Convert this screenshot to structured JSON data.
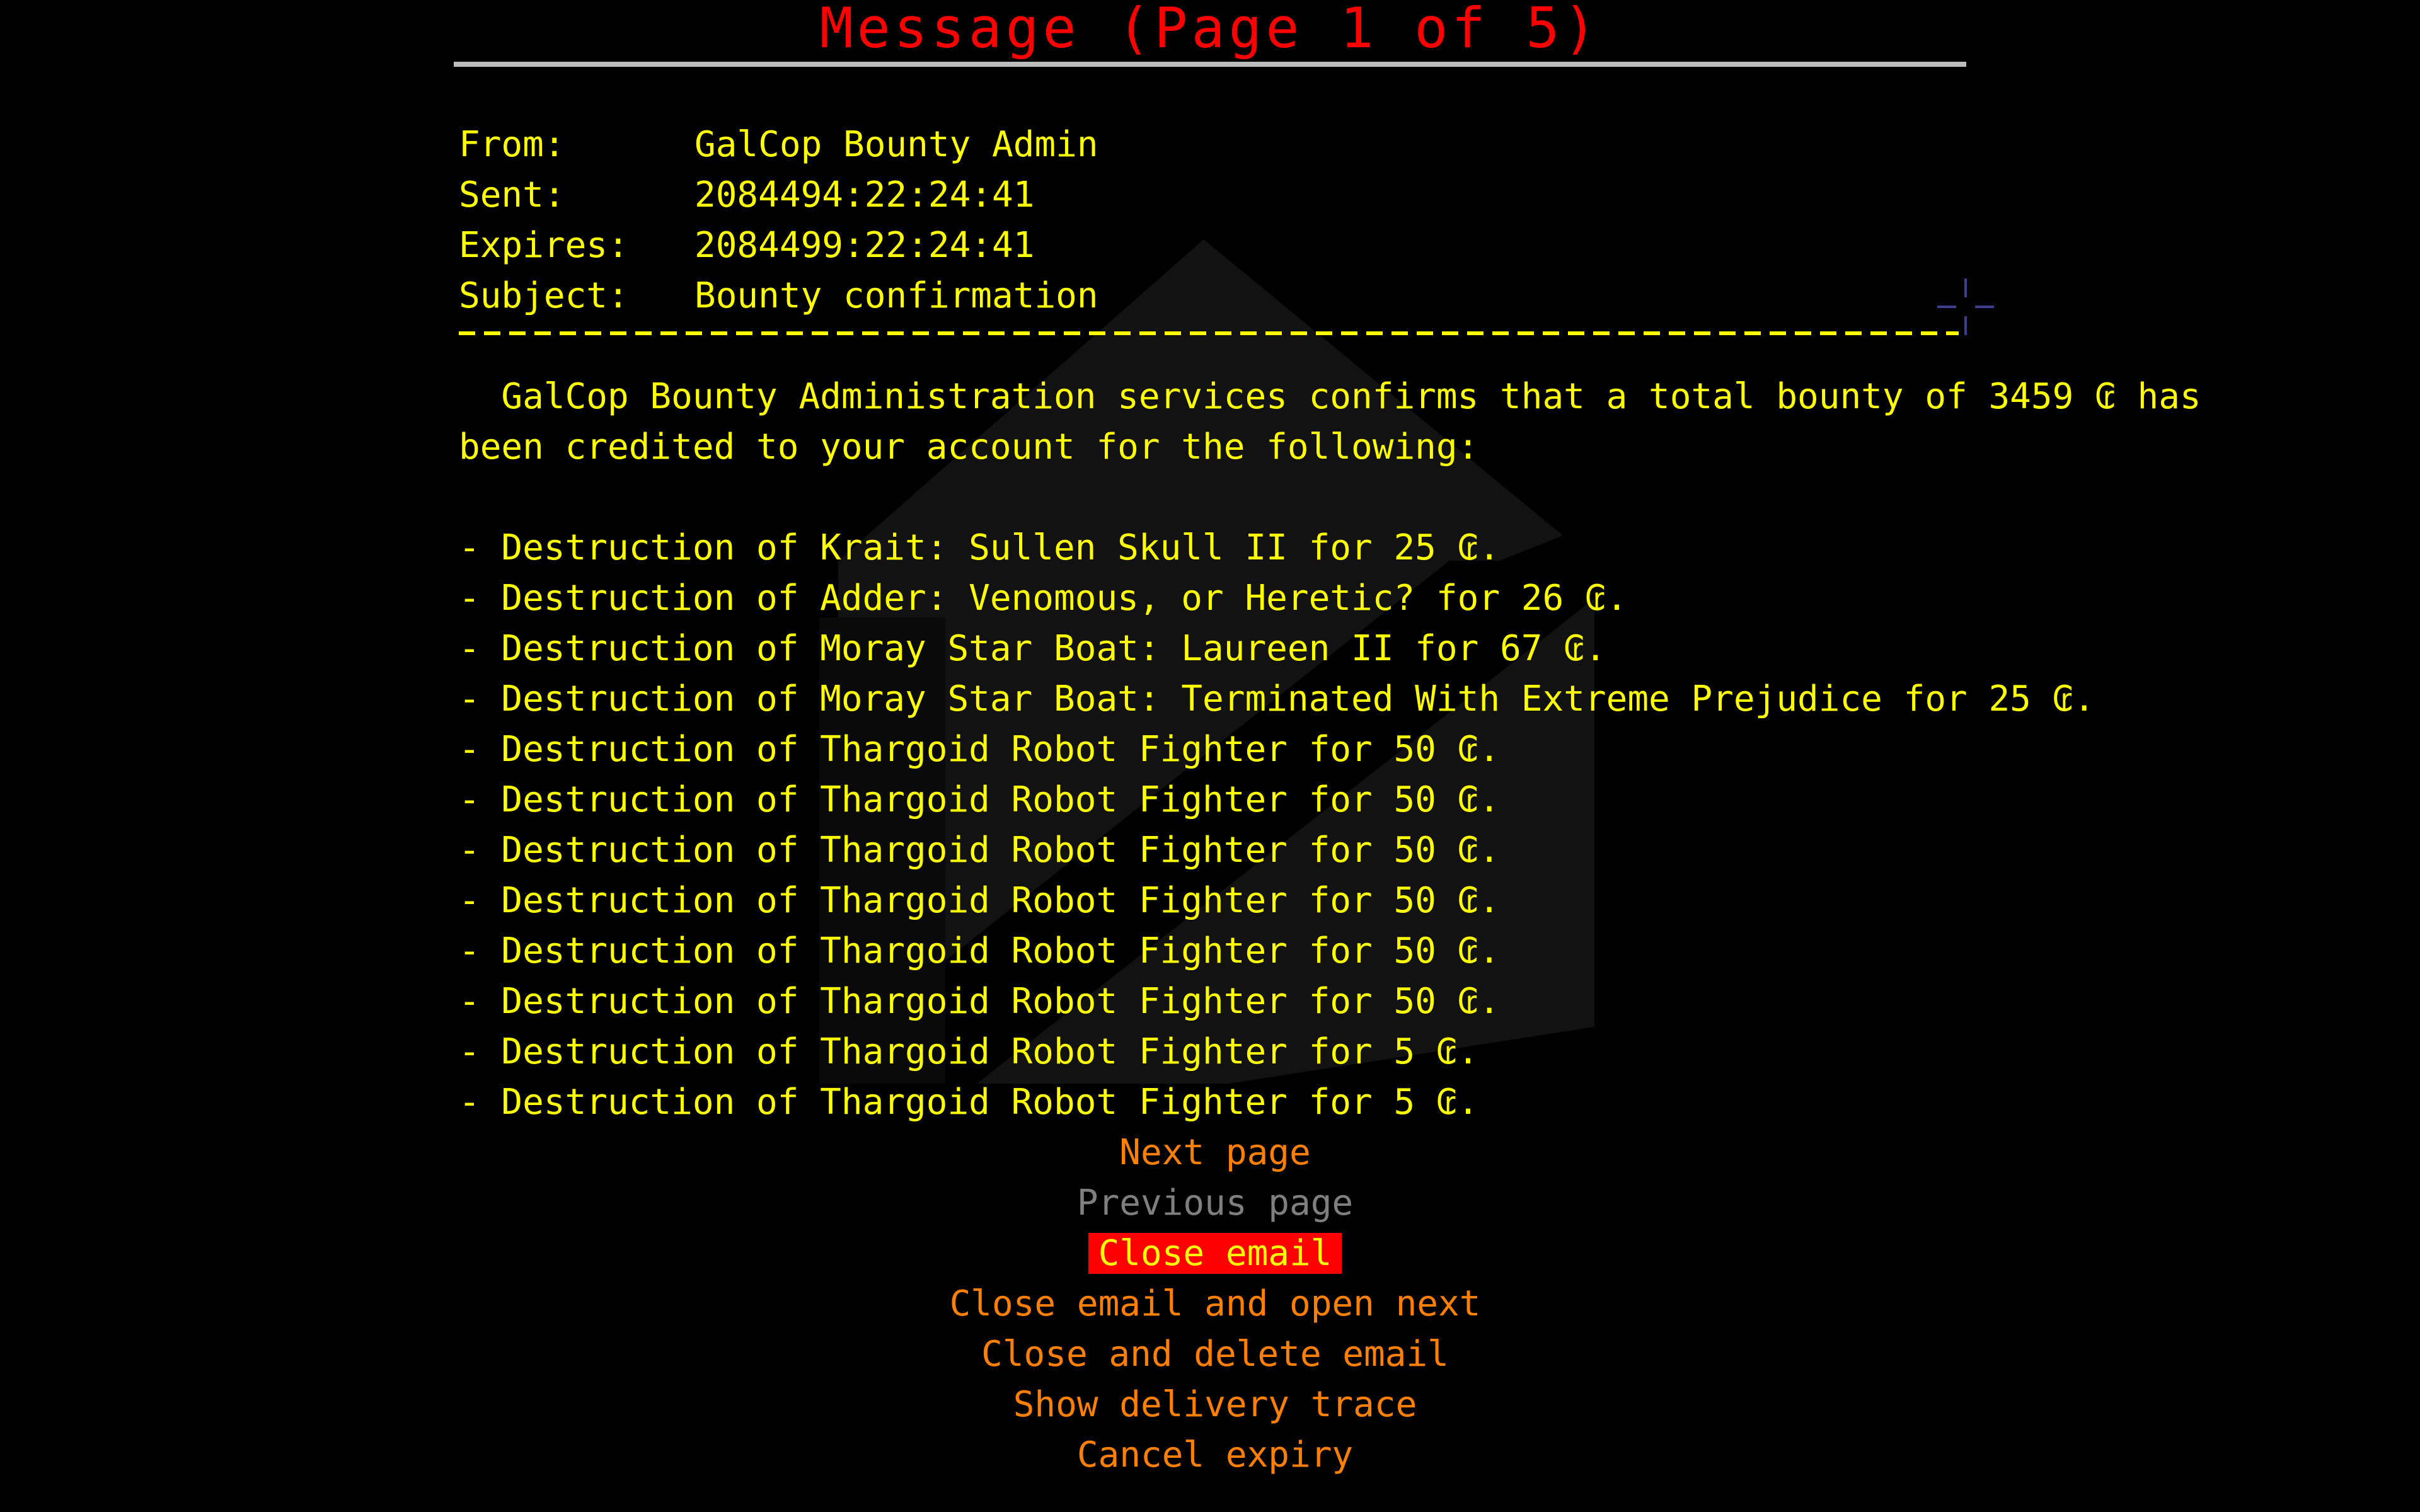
{
  "window": {
    "title": "Message (Page 1 of 5)"
  },
  "header": {
    "rows": [
      {
        "label": "From:",
        "value": "GalCop Bounty Admin"
      },
      {
        "label": "Sent:",
        "value": "2084494:22:24:41"
      },
      {
        "label": "Expires:",
        "value": "2084499:22:24:41"
      },
      {
        "label": "Subject:",
        "value": "Bounty confirmation"
      }
    ]
  },
  "body": {
    "intro_line_1": "  GalCop Bounty Administration services confirms that a total bounty of 3459 ₢ has",
    "intro_line_2": "been credited to your account for the following:",
    "items": [
      "- Destruction of Krait: Sullen Skull II for 25 ₢.",
      "- Destruction of Adder: Venomous, or Heretic? for 26 ₢.",
      "- Destruction of Moray Star Boat: Laureen II for 67 ₢.",
      "- Destruction of Moray Star Boat: Terminated With Extreme Prejudice for 25 ₢.",
      "- Destruction of Thargoid Robot Fighter for 50 ₢.",
      "- Destruction of Thargoid Robot Fighter for 50 ₢.",
      "- Destruction of Thargoid Robot Fighter for 50 ₢.",
      "- Destruction of Thargoid Robot Fighter for 50 ₢.",
      "- Destruction of Thargoid Robot Fighter for 50 ₢.",
      "- Destruction of Thargoid Robot Fighter for 50 ₢.",
      "- Destruction of Thargoid Robot Fighter for 5 ₢.",
      "- Destruction of Thargoid Robot Fighter for 5 ₢."
    ]
  },
  "menu": {
    "next_page": "Next page",
    "previous_page": "Previous page",
    "close_email": "Close email",
    "close_open_next": "Close email and open next",
    "close_delete": "Close and delete email",
    "show_trace": "Show delivery trace",
    "cancel_expiry": "Cancel expiry"
  },
  "colors": {
    "title": "#ff0000",
    "text": "#ffff00",
    "menu": "#ff8000",
    "menu_disabled": "#7f7f7f",
    "selection": "#ff0000"
  },
  "icons": {
    "watermark": "email-envelope-icon",
    "cursor": "crosshair-icon"
  }
}
